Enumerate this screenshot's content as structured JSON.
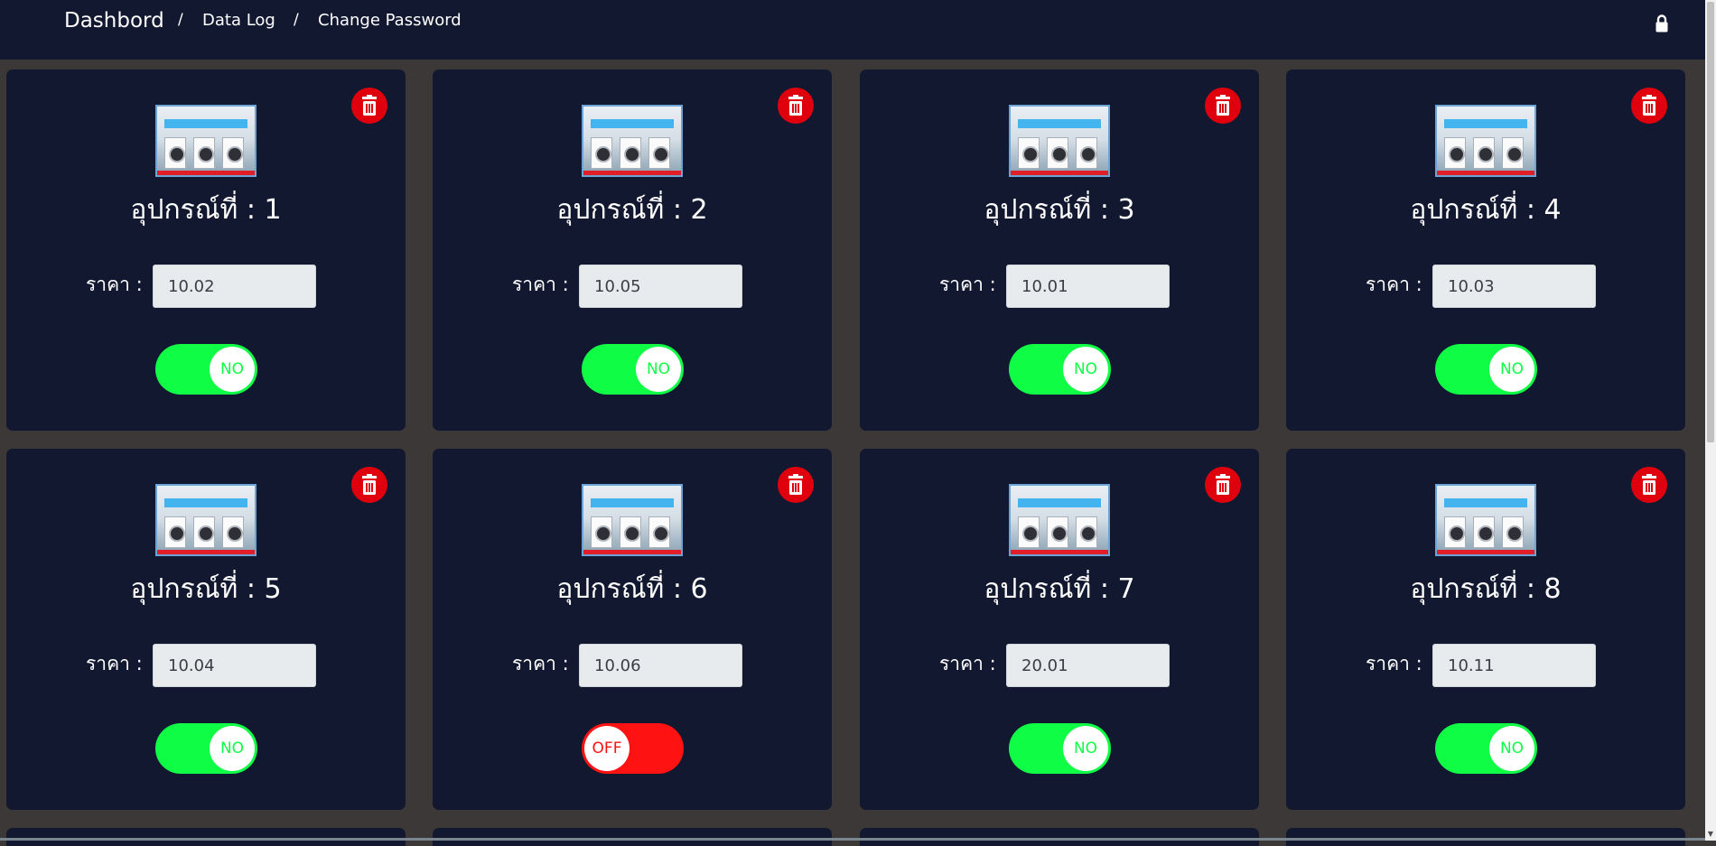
{
  "nav": {
    "brand": "Dashbord",
    "separator": "/",
    "links": [
      "Data Log",
      "Change Password"
    ],
    "lock_icon": "lock-icon"
  },
  "devices": [
    {
      "title": "อุปกรณ์ที่ : 1",
      "price_label": "ราคา :",
      "price": "10.02",
      "status": "NO",
      "on": true
    },
    {
      "title": "อุปกรณ์ที่ : 2",
      "price_label": "ราคา :",
      "price": "10.05",
      "status": "NO",
      "on": true
    },
    {
      "title": "อุปกรณ์ที่ : 3",
      "price_label": "ราคา :",
      "price": "10.01",
      "status": "NO",
      "on": true
    },
    {
      "title": "อุปกรณ์ที่ : 4",
      "price_label": "ราคา :",
      "price": "10.03",
      "status": "NO",
      "on": true
    },
    {
      "title": "อุปกรณ์ที่ : 5",
      "price_label": "ราคา :",
      "price": "10.04",
      "status": "NO",
      "on": true
    },
    {
      "title": "อุปกรณ์ที่ : 6",
      "price_label": "ราคา :",
      "price": "10.06",
      "status": "OFF",
      "on": false
    },
    {
      "title": "อุปกรณ์ที่ : 7",
      "price_label": "ราคา :",
      "price": "20.01",
      "status": "NO",
      "on": true
    },
    {
      "title": "อุปกรณ์ที่ : 8",
      "price_label": "ราคา :",
      "price": "10.11",
      "status": "NO",
      "on": true
    }
  ],
  "icons": {
    "delete": "trash-icon",
    "device_image": "laundry-machine-image"
  },
  "colors": {
    "background": "#3d3838",
    "panel": "#121830",
    "on": "#10fd46",
    "off": "#ff1212",
    "delete": "#e0000d"
  }
}
